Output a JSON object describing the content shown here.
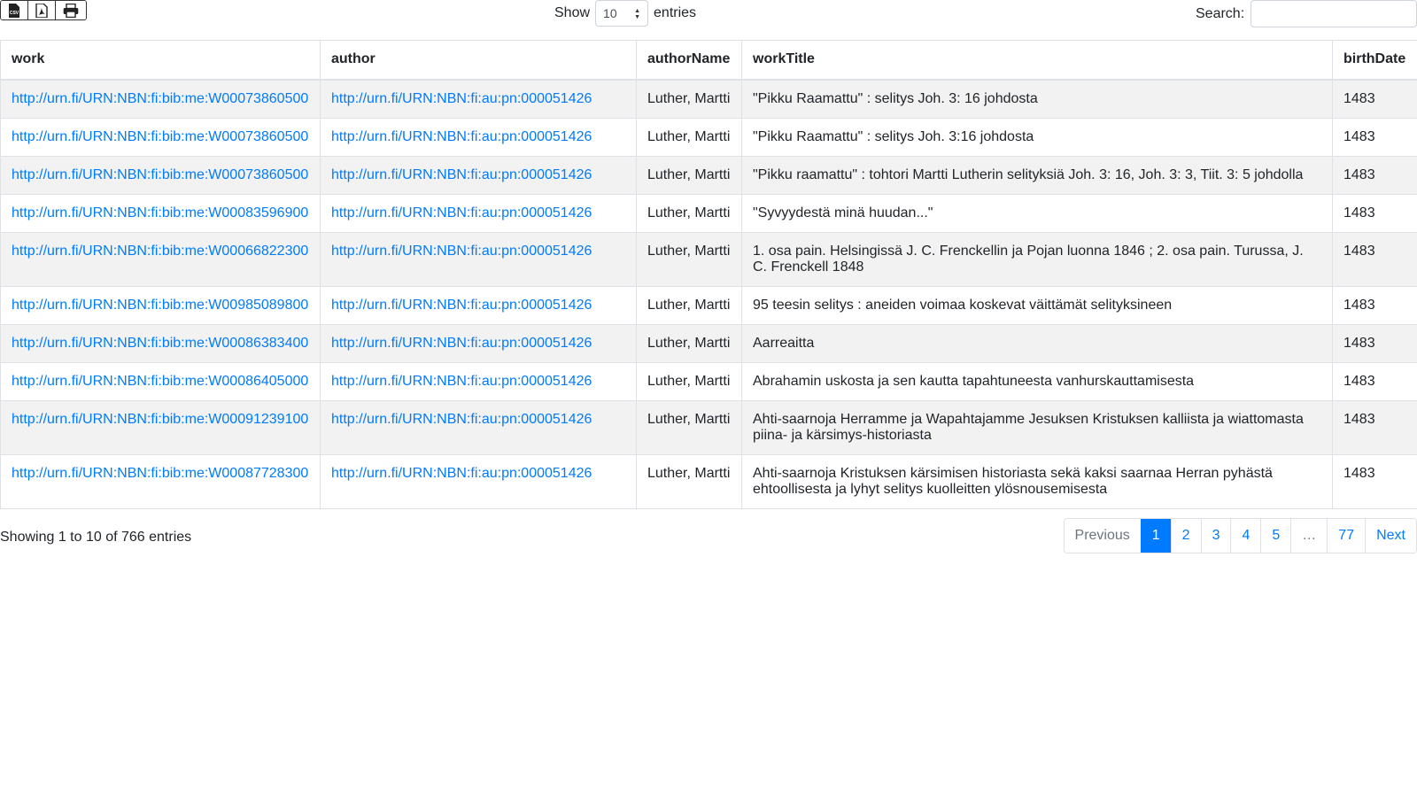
{
  "toolbar": {
    "buttons": [
      {
        "icon": "csv-file-icon",
        "label": "CSV"
      },
      {
        "icon": "pdf-file-icon"
      },
      {
        "icon": "print-icon"
      }
    ]
  },
  "length": {
    "prefix": "Show",
    "value": "10",
    "suffix": "entries"
  },
  "search": {
    "label": "Search:",
    "value": "",
    "placeholder": ""
  },
  "table": {
    "columns": [
      "work",
      "author",
      "authorName",
      "workTitle",
      "birthDate"
    ],
    "rows": [
      [
        "http://urn.fi/URN:NBN:fi:bib:me:W00073860500",
        "http://urn.fi/URN:NBN:fi:au:pn:000051426",
        "Luther, Martti",
        "\"Pikku Raamattu\" : selitys Joh. 3: 16 johdosta",
        "1483"
      ],
      [
        "http://urn.fi/URN:NBN:fi:bib:me:W00073860500",
        "http://urn.fi/URN:NBN:fi:au:pn:000051426",
        "Luther, Martti",
        "\"Pikku Raamattu\" : selitys Joh. 3:16 johdosta",
        "1483"
      ],
      [
        "http://urn.fi/URN:NBN:fi:bib:me:W00073860500",
        "http://urn.fi/URN:NBN:fi:au:pn:000051426",
        "Luther, Martti",
        "\"Pikku raamattu\" : tohtori Martti Lutherin selityksiä Joh. 3: 16, Joh. 3: 3, Tiit. 3: 5 johdolla",
        "1483"
      ],
      [
        "http://urn.fi/URN:NBN:fi:bib:me:W00083596900",
        "http://urn.fi/URN:NBN:fi:au:pn:000051426",
        "Luther, Martti",
        "\"Syvyydestä minä huudan...\"",
        "1483"
      ],
      [
        "http://urn.fi/URN:NBN:fi:bib:me:W00066822300",
        "http://urn.fi/URN:NBN:fi:au:pn:000051426",
        "Luther, Martti",
        "1. osa pain. Helsingissä J. C. Frenckellin ja Pojan luonna 1846 ; 2. osa pain. Turussa, J. C. Frenckell 1848",
        "1483"
      ],
      [
        "http://urn.fi/URN:NBN:fi:bib:me:W00985089800",
        "http://urn.fi/URN:NBN:fi:au:pn:000051426",
        "Luther, Martti",
        "95 teesin selitys : aneiden voimaa koskevat väittämät selityksineen",
        "1483"
      ],
      [
        "http://urn.fi/URN:NBN:fi:bib:me:W00086383400",
        "http://urn.fi/URN:NBN:fi:au:pn:000051426",
        "Luther, Martti",
        "Aarreaitta",
        "1483"
      ],
      [
        "http://urn.fi/URN:NBN:fi:bib:me:W00086405000",
        "http://urn.fi/URN:NBN:fi:au:pn:000051426",
        "Luther, Martti",
        "Abrahamin uskosta ja sen kautta tapahtuneesta vanhurskauttamisesta",
        "1483"
      ],
      [
        "http://urn.fi/URN:NBN:fi:bib:me:W00091239100",
        "http://urn.fi/URN:NBN:fi:au:pn:000051426",
        "Luther, Martti",
        "Ahti-saarnoja Herramme ja Wapahtajamme Jesuksen Kristuksen kalliista ja wiattomasta piina- ja kärsimys-historiasta",
        "1483"
      ],
      [
        "http://urn.fi/URN:NBN:fi:bib:me:W00087728300",
        "http://urn.fi/URN:NBN:fi:au:pn:000051426",
        "Luther, Martti",
        "Ahti-saarnoja Kristuksen kärsimisen historiasta sekä kaksi saarnaa Herran pyhästä ehtoollisesta ja lyhyt selitys kuolleitten ylösnousemisesta",
        "1483"
      ]
    ]
  },
  "info": "Showing 1 to 10 of 766 entries",
  "pagination": {
    "items": [
      {
        "label": "Previous",
        "state": "disabled"
      },
      {
        "label": "1",
        "state": "active"
      },
      {
        "label": "2",
        "state": "normal"
      },
      {
        "label": "3",
        "state": "normal"
      },
      {
        "label": "4",
        "state": "normal"
      },
      {
        "label": "5",
        "state": "normal"
      },
      {
        "label": "…",
        "state": "disabled"
      },
      {
        "label": "77",
        "state": "normal"
      },
      {
        "label": "Next",
        "state": "normal"
      }
    ]
  },
  "colors": {
    "link": "#007bff",
    "active": "#007bff",
    "stripe": "#f2f2f2"
  }
}
